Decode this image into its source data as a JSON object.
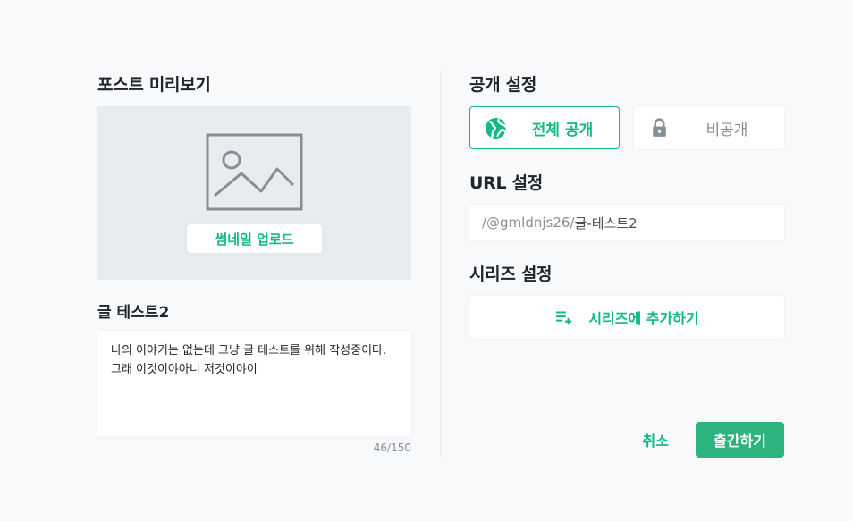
{
  "preview": {
    "title": "포스트 미리보기",
    "upload_label": "썸네일 업로드",
    "post_title": "글 테스트2",
    "description": "나의 이야기는 없는데 그냥 글 테스트를 위해 작성중이다.\n그래 이것이야아니 저것이야이",
    "counter": "46/150"
  },
  "visibility": {
    "title": "공개 설정",
    "public_label": "전체 공개",
    "private_label": "비공개",
    "selected": "public"
  },
  "url": {
    "title": "URL 설정",
    "prefix": "/@gmldnjs26/",
    "slug": "글-테스트2"
  },
  "series": {
    "title": "시리즈 설정",
    "add_label": "시리즈에 추가하기"
  },
  "actions": {
    "cancel_label": "취소",
    "publish_label": "출간하기"
  },
  "colors": {
    "accent": "#12b886",
    "publish_bg": "#2db37d",
    "thumb_bg": "#e9ecef"
  },
  "icons": {
    "thumbnail": "image-placeholder-icon",
    "public": "globe-icon",
    "private": "lock-icon",
    "series": "playlist-add-icon"
  }
}
